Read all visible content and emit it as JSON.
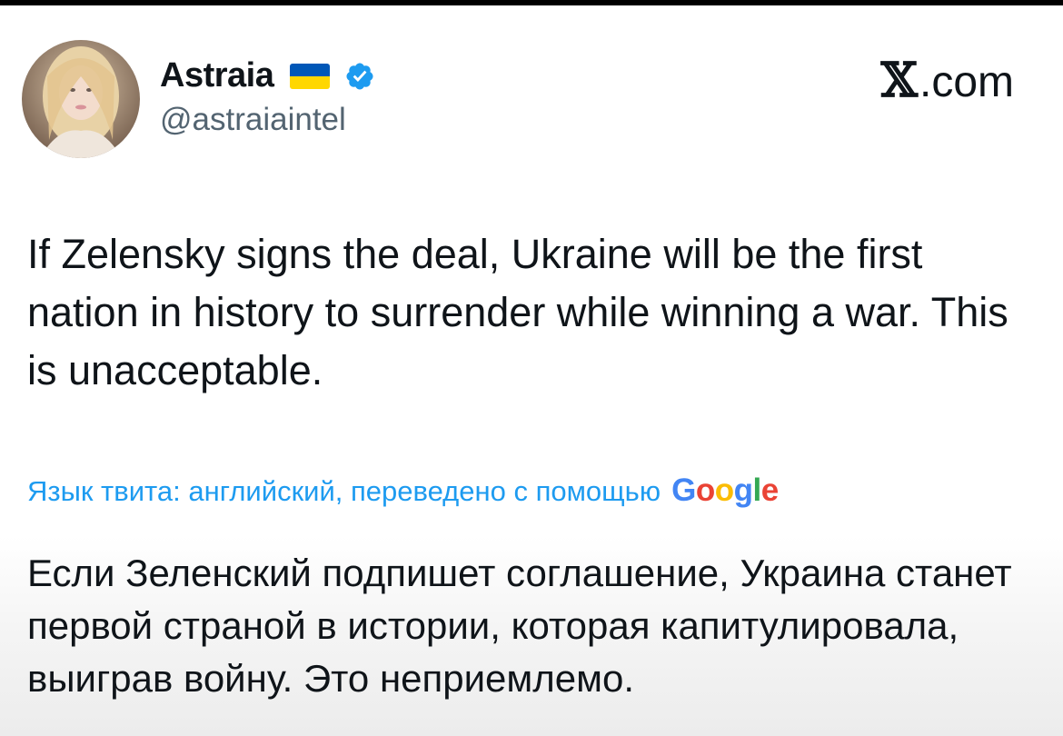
{
  "author": {
    "display_name": "Astraia",
    "handle": "@astraiaintel",
    "flag_colors": {
      "blue": "#0057b7",
      "yellow": "#ffd700"
    },
    "verified_color": "#1d9bf0"
  },
  "site_label": "com",
  "site_mark": "𝕏",
  "tweet": {
    "text": "If Zelensky signs the deal, Ukraine will be the first nation in history to surrender while winning a war. This is unacceptable."
  },
  "translation": {
    "note": "Язык твита: английский, переведено с помощью",
    "provider_letters": [
      "G",
      "o",
      "o",
      "g",
      "l",
      "e"
    ],
    "text": "Если Зеленский подпишет соглашение, Украина станет первой страной в истории, которая капитулировала, выиграв войну. Это неприемлемо."
  },
  "colors": {
    "link": "#1d9bf0",
    "secondary_text": "#536471",
    "primary_text": "#0f1419"
  }
}
